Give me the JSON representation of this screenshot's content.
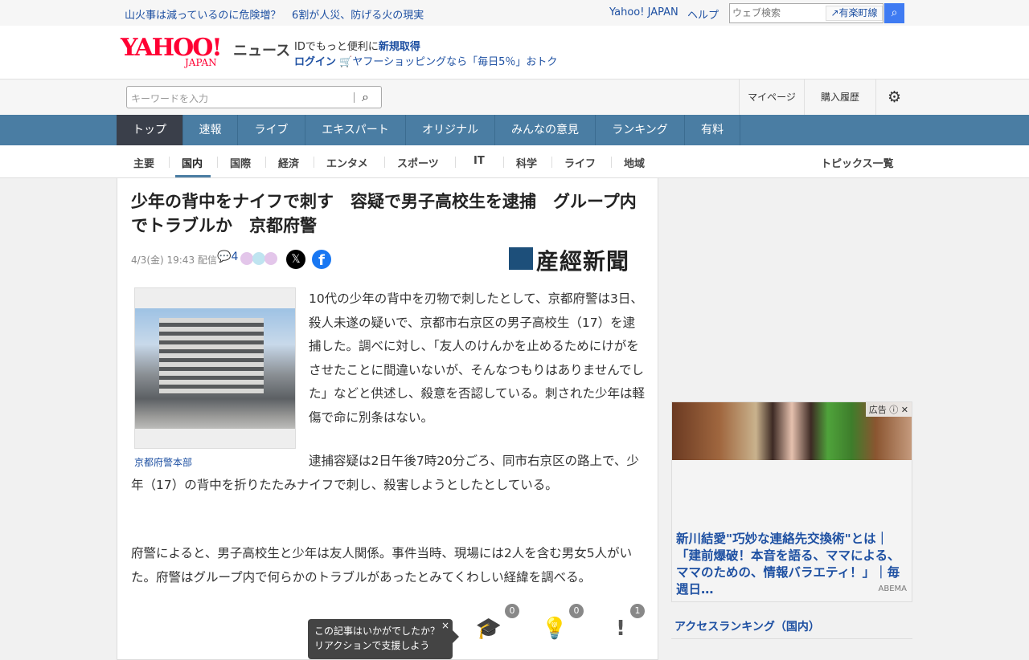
{
  "topbar": {
    "links": [
      "山火事は減っているのに危険増？",
      "6割が人災、防げる火の現実"
    ],
    "yahoo_japan": "Yahoo! JAPAN",
    "help": "ヘルプ",
    "search_placeholder": "ウェブ検索",
    "suggest": "有楽町線"
  },
  "header": {
    "logo_text": "YAHOO!",
    "logo_sub": "JAPAN",
    "service": "ニュース",
    "id_text": "IDでもっと便利に",
    "signup": "新規取得",
    "login": "ログイン",
    "shopping": "ヤフーショッピングなら「毎日5％」おトク"
  },
  "search": {
    "placeholder": "キーワードを入力",
    "mypage": "マイページ",
    "history": "購入履歴"
  },
  "nav": [
    {
      "label": "トップ"
    },
    {
      "label": "速報"
    },
    {
      "label": "ライブ"
    },
    {
      "label": "エキスパート"
    },
    {
      "label": "オリジナル"
    },
    {
      "label": "みんなの意見"
    },
    {
      "label": "ランキング"
    },
    {
      "label": "有料"
    }
  ],
  "subnav": [
    {
      "label": "主要"
    },
    {
      "label": "国内"
    },
    {
      "label": "国際"
    },
    {
      "label": "経済"
    },
    {
      "label": "エンタメ"
    },
    {
      "label": "スポーツ"
    },
    {
      "label": "IT"
    },
    {
      "label": "科学"
    },
    {
      "label": "ライフ"
    },
    {
      "label": "地域"
    }
  ],
  "topics": "トピックス一覧",
  "article": {
    "title": "少年の背中をナイフで刺す　容疑で男子高校生を逮捕　グループ内でトラブルか　京都府警",
    "date": "4/3(金) 19:43 配信",
    "comments": "4",
    "source": "産經新聞",
    "source_box": "産經新聞",
    "caption": "京都府警本部",
    "p1": "10代の少年の背中を刃物で刺したとして、京都府警は3日、殺人未遂の疑いで、京都市右京区の男子高校生（17）を逮捕した。調べに対し、「友人のけんかを止めるためにけがをさせたことに間違いないが、そんなつもりはありませんでした」などと供述し、殺意を否認している。刺された少年は軽傷で命に別条はない。",
    "p2a": "逮捕容疑は2日午後7時20分ごろ、同市右京区の路上で、少年（17）の背中を折りたたみナイフで刺し、殺害しようとしたとしている。",
    "p3": "府警によると、男子高校生と少年は友人関係。事件当時、現場には2人を含む男女5人がいた。府警はグループ内で何らかのトラブルがあったとみてくわしい経緯を調べる。"
  },
  "reactions": {
    "tooltip1": "この記事はいかがでしたか？",
    "tooltip2": "リアクションで支援しよう",
    "learn": "0",
    "idea": "0",
    "notice": "1"
  },
  "ad": {
    "label": "広告",
    "title": "新川結愛\"巧妙な連絡先交換術\"とは｜「建前爆破！本音を語る、ママによる、ママのための、情報バラエティ！」｜毎週日…",
    "source": "ABEMA"
  },
  "ranking": "アクセスランキング（国内）"
}
